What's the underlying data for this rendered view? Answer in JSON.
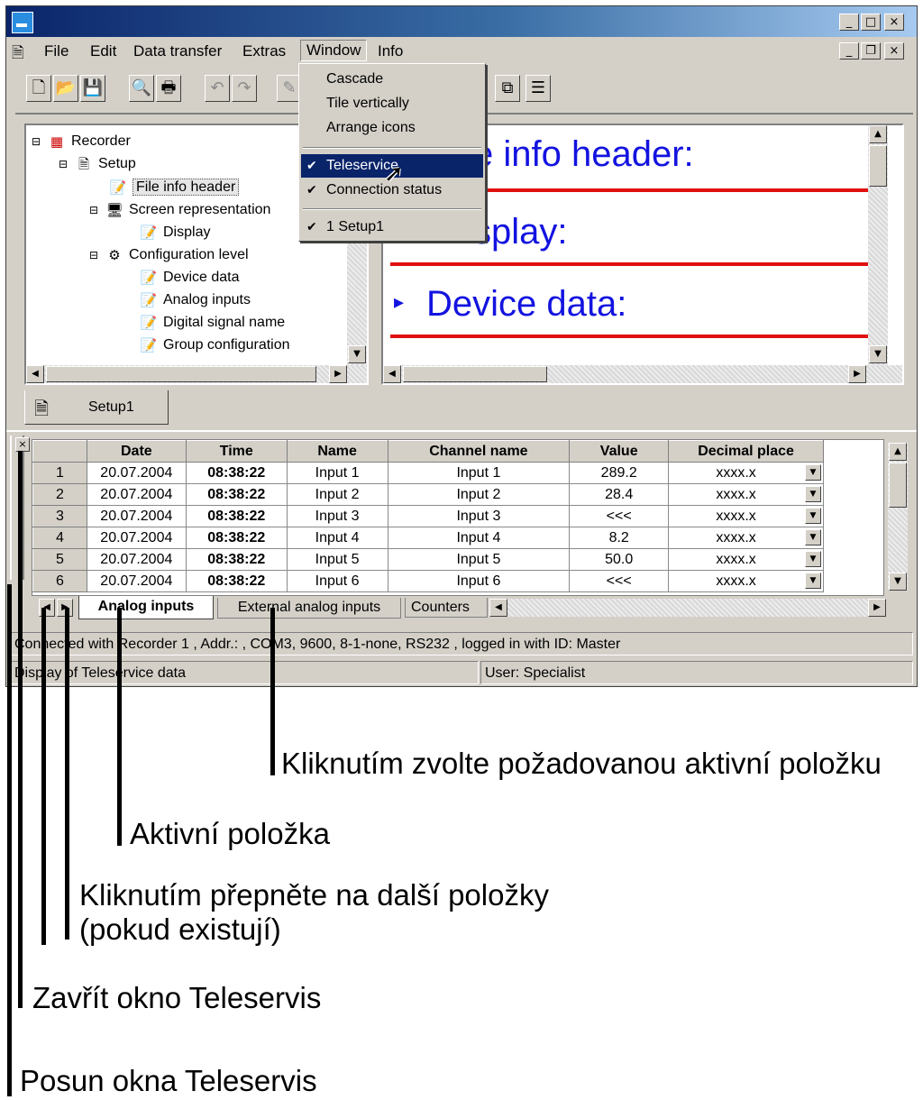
{
  "menu": {
    "file": "File",
    "edit": "Edit",
    "data_transfer": "Data transfer",
    "extras": "Extras",
    "window": "Window",
    "info": "Info"
  },
  "window_menu": {
    "items": [
      "Cascade",
      "Tile vertically",
      "Arrange icons",
      "Teleservice",
      "Connection status",
      "1 Setup1"
    ],
    "checkmark": "✔"
  },
  "tree": {
    "root": "Recorder",
    "setup": "Setup",
    "file_info_header": "File info header",
    "screen_representation": "Screen representation",
    "display": "Display",
    "configuration_level": "Configuration level",
    "device_data": "Device data",
    "analog_inputs": "Analog inputs",
    "digital_signal_name": "Digital signal name",
    "group_configuration": "Group configuration"
  },
  "preview": {
    "line1": "e info header:",
    "line2": "splay:",
    "line3": "Device data:"
  },
  "doc_tab": "Setup1",
  "table": {
    "headers": [
      "Date",
      "Time",
      "Name",
      "Channel name",
      "Value",
      "Decimal place"
    ],
    "rows": [
      [
        "1",
        "20.07.2004",
        "08:38:22",
        "Input 1",
        "Input 1",
        "289.2",
        "xxxx.x"
      ],
      [
        "2",
        "20.07.2004",
        "08:38:22",
        "Input 2",
        "Input 2",
        "28.4",
        "xxxx.x"
      ],
      [
        "3",
        "20.07.2004",
        "08:38:22",
        "Input 3",
        "Input 3",
        "<<<",
        "xxxx.x"
      ],
      [
        "4",
        "20.07.2004",
        "08:38:22",
        "Input 4",
        "Input 4",
        "8.2",
        "xxxx.x"
      ],
      [
        "5",
        "20.07.2004",
        "08:38:22",
        "Input 5",
        "Input 5",
        "50.0",
        "xxxx.x"
      ],
      [
        "6",
        "20.07.2004",
        "08:38:22",
        "Input 6",
        "Input 6",
        "<<<",
        "xxxx.x"
      ]
    ]
  },
  "sheet_tabs": {
    "active": "Analog inputs",
    "tab2": "External analog inputs",
    "tab3": "Counters"
  },
  "status": {
    "connection": "Connected with Recorder 1 , Addr.: , COM3, 9600, 8-1-none, RS232 , logged in with ID: Master",
    "left": "Display of Teleservice data",
    "user": "User: Specialist"
  },
  "annotations": {
    "click_select": "Kliknutím zvolte požadovanou aktivní položku",
    "active_item": "Aktivní položka",
    "switch_line1": "Kliknutím přepněte na další položky",
    "switch_line2": "(pokud existují)",
    "close": "Zavřít okno Teleservis",
    "move": "Posun okna Teleservis"
  },
  "colors": {
    "title_start": "#0a246a",
    "highlight": "#0a246a",
    "preview_blue": "#1313e0",
    "divider_red": "#e01010"
  }
}
